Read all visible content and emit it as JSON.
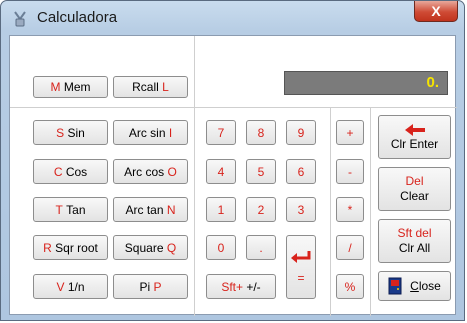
{
  "window": {
    "title": "Calculadora",
    "close_glyph": "X"
  },
  "display": {
    "value": "0."
  },
  "memory": {
    "mem": {
      "key": "M",
      "label": "Mem"
    },
    "rcall": {
      "label": "Rcall",
      "key": "L"
    }
  },
  "functions": [
    {
      "a_key": "S",
      "a_label": "Sin",
      "b_label": "Arc  sin",
      "b_key": "I"
    },
    {
      "a_key": "C",
      "a_label": "Cos",
      "b_label": "Arc cos",
      "b_key": "O"
    },
    {
      "a_key": "T",
      "a_label": "Tan",
      "b_label": "Arc tan",
      "b_key": "N"
    },
    {
      "a_key": "R",
      "a_label": "Sqr root",
      "b_label": "Square",
      "b_key": "Q"
    },
    {
      "a_key": "V",
      "a_label": "1/n",
      "b_label": "Pi",
      "b_key": "P"
    }
  ],
  "keypad": {
    "rows": [
      [
        "7",
        "8",
        "9"
      ],
      [
        "4",
        "5",
        "6"
      ],
      [
        "1",
        "2",
        "3"
      ]
    ],
    "zero": "0",
    "dot": ".",
    "sft": "Sft+",
    "plusminus": "+/-",
    "equals": "="
  },
  "operators": [
    "+",
    "-",
    "*",
    "/",
    "%"
  ],
  "actions": {
    "clr_enter": "Clr Enter",
    "del_top": "Del",
    "del_bottom": "Clear",
    "sft_del_top": "Sft del",
    "sft_del_bottom": "Clr All",
    "close_label": "Close",
    "close_mnemonic": "C",
    "close_rest": "lose"
  },
  "colors": {
    "accent": "#d8231c",
    "display_bg": "#7b7b7b",
    "display_fg": "#f5e400"
  }
}
